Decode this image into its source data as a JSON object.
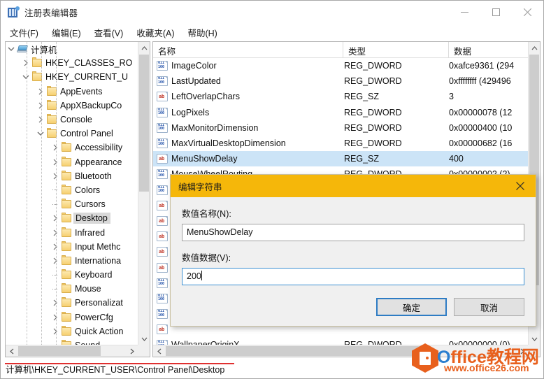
{
  "window": {
    "title": "注册表编辑器",
    "icon": "registry-editor-icon",
    "controls": {
      "minimize": "minimize-icon",
      "maximize": "maximize-icon",
      "close": "close-icon"
    }
  },
  "menubar": {
    "items": [
      {
        "label": "文件(F)"
      },
      {
        "label": "编辑(E)"
      },
      {
        "label": "查看(V)"
      },
      {
        "label": "收藏夹(A)"
      },
      {
        "label": "帮助(H)"
      }
    ]
  },
  "tree": {
    "nodes": [
      {
        "label": "计算机",
        "depth": 0,
        "twist": "down",
        "icon": "computer"
      },
      {
        "label": "HKEY_CLASSES_RO",
        "depth": 1,
        "twist": "right",
        "icon": "folder"
      },
      {
        "label": "HKEY_CURRENT_U",
        "depth": 1,
        "twist": "down",
        "icon": "folder"
      },
      {
        "label": "AppEvents",
        "depth": 2,
        "twist": "right",
        "icon": "folder"
      },
      {
        "label": "AppXBackupCo",
        "depth": 2,
        "twist": "right",
        "icon": "folder"
      },
      {
        "label": "Console",
        "depth": 2,
        "twist": "right",
        "icon": "folder"
      },
      {
        "label": "Control Panel",
        "depth": 2,
        "twist": "down",
        "icon": "folder"
      },
      {
        "label": "Accessibility",
        "depth": 3,
        "twist": "right",
        "icon": "folder"
      },
      {
        "label": "Appearance",
        "depth": 3,
        "twist": "right",
        "icon": "folder"
      },
      {
        "label": "Bluetooth",
        "depth": 3,
        "twist": "right",
        "icon": "folder"
      },
      {
        "label": "Colors",
        "depth": 3,
        "twist": "none",
        "icon": "folder"
      },
      {
        "label": "Cursors",
        "depth": 3,
        "twist": "none",
        "icon": "folder"
      },
      {
        "label": "Desktop",
        "depth": 3,
        "twist": "right",
        "icon": "folder",
        "selected": true
      },
      {
        "label": "Infrared",
        "depth": 3,
        "twist": "right",
        "icon": "folder"
      },
      {
        "label": "Input Methc",
        "depth": 3,
        "twist": "right",
        "icon": "folder"
      },
      {
        "label": "Internationa",
        "depth": 3,
        "twist": "right",
        "icon": "folder"
      },
      {
        "label": "Keyboard",
        "depth": 3,
        "twist": "none",
        "icon": "folder"
      },
      {
        "label": "Mouse",
        "depth": 3,
        "twist": "none",
        "icon": "folder"
      },
      {
        "label": "Personalizat",
        "depth": 3,
        "twist": "right",
        "icon": "folder"
      },
      {
        "label": "PowerCfg",
        "depth": 3,
        "twist": "right",
        "icon": "folder"
      },
      {
        "label": "Quick Action",
        "depth": 3,
        "twist": "right",
        "icon": "folder"
      },
      {
        "label": "Sound",
        "depth": 3,
        "twist": "none",
        "icon": "folder"
      }
    ]
  },
  "list": {
    "columns": [
      {
        "label": "名称"
      },
      {
        "label": "类型"
      },
      {
        "label": "数据"
      }
    ],
    "rows": [
      {
        "name": "ImageColor",
        "type": "REG_DWORD",
        "data": "0xafce9361 (294",
        "icon": "dword"
      },
      {
        "name": "LastUpdated",
        "type": "REG_DWORD",
        "data": "0xffffffff (429496",
        "icon": "dword"
      },
      {
        "name": "LeftOverlapChars",
        "type": "REG_SZ",
        "data": "3",
        "icon": "sz"
      },
      {
        "name": "LogPixels",
        "type": "REG_DWORD",
        "data": "0x00000078 (12",
        "icon": "dword"
      },
      {
        "name": "MaxMonitorDimension",
        "type": "REG_DWORD",
        "data": "0x00000400 (10",
        "icon": "dword"
      },
      {
        "name": "MaxVirtualDesktopDimension",
        "type": "REG_DWORD",
        "data": "0x00000682 (16",
        "icon": "dword"
      },
      {
        "name": "MenuShowDelay",
        "type": "REG_SZ",
        "data": "400",
        "icon": "sz",
        "selected": true
      },
      {
        "name": "MouseWheelRouting",
        "type": "REG_DWORD",
        "data": "0x00000002 (2)",
        "icon": "dword"
      },
      {
        "name": "",
        "type": "",
        "data": "",
        "icon": "dword"
      },
      {
        "name": "",
        "type": "",
        "data": "",
        "icon": "sz"
      },
      {
        "name": "",
        "type": "",
        "data": "",
        "icon": "sz"
      },
      {
        "name": "",
        "type": "",
        "data": "",
        "icon": "sz"
      },
      {
        "name": "",
        "type": "",
        "data": "",
        "icon": "sz"
      },
      {
        "name": "",
        "type": "",
        "data": "",
        "icon": "sz"
      },
      {
        "name": "",
        "type": "",
        "data": "",
        "icon": "dword"
      },
      {
        "name": "",
        "type": "",
        "data": "",
        "icon": "dword"
      },
      {
        "name": "",
        "type": "",
        "data": "",
        "icon": "dword"
      },
      {
        "name": "",
        "type": "",
        "data": "",
        "icon": "sz"
      },
      {
        "name": "WallpaperOriginX",
        "type": "REG_DWORD",
        "data": "0x00000000 (0)",
        "icon": "dword"
      }
    ]
  },
  "dialog": {
    "title": "编辑字符串",
    "close_icon": "close-icon",
    "name_label": "数值名称(N):",
    "name_value": "MenuShowDelay",
    "data_label": "数值数据(V):",
    "data_value": "200",
    "ok_label": "确定",
    "cancel_label": "取消"
  },
  "statusbar": {
    "path": "计算机\\HKEY_CURRENT_USER\\Control Panel\\Desktop"
  },
  "watermark": {
    "brand_o": "O",
    "brand_ffice": "ffice",
    "brand_cn": "教程网",
    "url": "www.office26.com"
  },
  "colors": {
    "dialog_titlebar": "#f5b70a",
    "selection": "#cce4f7",
    "tree_selection": "#d8d8d8",
    "default_button_border": "#2e7cc4",
    "underline": "#e03030",
    "watermark_orange": "#e8601d",
    "watermark_blue": "#2b7fd0"
  }
}
